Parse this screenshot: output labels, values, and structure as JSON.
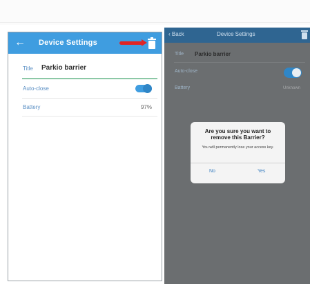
{
  "left_screen": {
    "appbar": {
      "back_glyph": "←",
      "title": "Device Settings",
      "delete_icon": "trash-icon",
      "highlight_arrow_color": "#e02424",
      "accent_color": "#3f9de0"
    },
    "title_row": {
      "label": "Title",
      "value": "Parkio barrier"
    },
    "auto_close_row": {
      "label": "Auto-close",
      "toggle_on": true
    },
    "battery_row": {
      "label": "Battery",
      "value": "97%"
    }
  },
  "right_screen": {
    "navbar": {
      "back_label": "Back",
      "title": "Device Settings",
      "delete_icon": "trash-icon",
      "navbar_color": "#2f6591"
    },
    "title_row": {
      "label": "Title",
      "value": "Parkio barrier"
    },
    "auto_close_row": {
      "label": "Auto-close",
      "toggle_on": true
    },
    "battery_row": {
      "label": "Battery",
      "value": "Unknown"
    },
    "dialog": {
      "title": "Are you sure you want to remove this Barrier?",
      "message": "You will permanently lose your access key.",
      "no_label": "No",
      "yes_label": "Yes"
    }
  }
}
